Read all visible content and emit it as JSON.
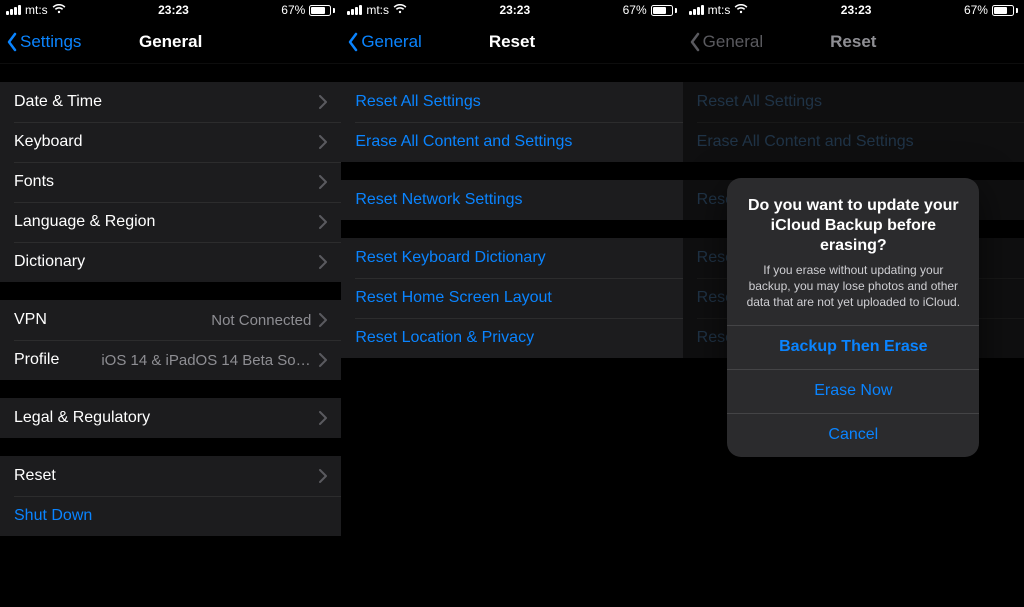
{
  "status": {
    "carrier": "mt:s",
    "time": "23:23",
    "battery_pct": "67%"
  },
  "screen1": {
    "nav": {
      "back": "Settings",
      "title": "General"
    },
    "groups": [
      [
        {
          "label": "Date & Time",
          "chevron": true
        },
        {
          "label": "Keyboard",
          "chevron": true
        },
        {
          "label": "Fonts",
          "chevron": true
        },
        {
          "label": "Language & Region",
          "chevron": true
        },
        {
          "label": "Dictionary",
          "chevron": true
        }
      ],
      [
        {
          "label": "VPN",
          "detail": "Not Connected",
          "chevron": true
        },
        {
          "label": "Profile",
          "detail": "iOS 14 & iPadOS 14 Beta Softwar…",
          "chevron": true
        }
      ],
      [
        {
          "label": "Legal & Regulatory",
          "chevron": true
        }
      ],
      [
        {
          "label": "Reset",
          "chevron": true
        },
        {
          "label": "Shut Down",
          "blue": true
        }
      ]
    ]
  },
  "screen2": {
    "nav": {
      "back": "General",
      "title": "Reset"
    },
    "groups": [
      [
        {
          "label": "Reset All Settings"
        },
        {
          "label": "Erase All Content and Settings"
        }
      ],
      [
        {
          "label": "Reset Network Settings"
        }
      ],
      [
        {
          "label": "Reset Keyboard Dictionary"
        },
        {
          "label": "Reset Home Screen Layout"
        },
        {
          "label": "Reset Location & Privacy"
        }
      ]
    ]
  },
  "screen3": {
    "nav": {
      "back": "General",
      "title": "Reset"
    },
    "groups": [
      [
        {
          "label": "Reset All Settings"
        },
        {
          "label": "Erase All Content and Settings"
        }
      ],
      [
        {
          "label": "Rese"
        }
      ],
      [
        {
          "label": "Rese"
        },
        {
          "label": "Rese"
        },
        {
          "label": "Rese"
        }
      ]
    ],
    "alert": {
      "title": "Do you want to update your iCloud Backup before erasing?",
      "message": "If you erase without updating your backup, you may lose photos and other data that are not yet uploaded to iCloud.",
      "primary": "Backup Then Erase",
      "secondary": "Erase Now",
      "cancel": "Cancel"
    }
  }
}
